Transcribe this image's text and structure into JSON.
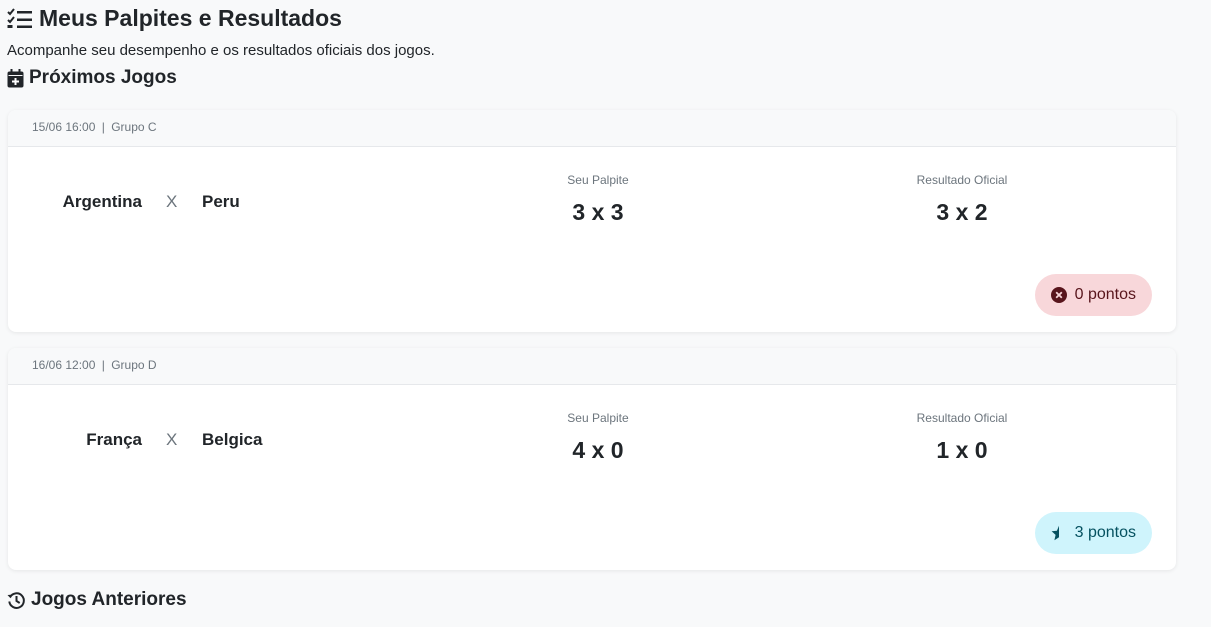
{
  "header": {
    "title": "Meus Palpites e Resultados",
    "subtitle": "Acompanhe seu desempenho e os resultados oficiais dos jogos.",
    "title_icon": "list-check-icon"
  },
  "sections": {
    "upcoming": {
      "title": "Próximos Jogos",
      "icon": "calendar-plus-icon"
    },
    "previous": {
      "title": "Jogos Anteriores",
      "icon": "clock-history-icon"
    }
  },
  "matches": [
    {
      "datetime": "15/06 16:00",
      "separator": "|",
      "group": "Grupo C",
      "home": "Argentina",
      "vs": "X",
      "away": "Peru",
      "guess_label": "Seu Palpite",
      "guess": "3 x 3",
      "result_label": "Resultado Oficial",
      "result": "3 x 2",
      "points": "0 pontos",
      "points_icon": "x-circle-icon"
    },
    {
      "datetime": "16/06 12:00",
      "separator": "|",
      "group": "Grupo D",
      "home": "França",
      "vs": "X",
      "away": "Belgica",
      "guess_label": "Seu Palpite",
      "guess": "4 x 0",
      "result_label": "Resultado Oficial",
      "result": "1 x 0",
      "points": "3 pontos",
      "points_icon": "star-half-icon"
    }
  ],
  "colors": {
    "zero_badge_bg": "#f8d7da",
    "zero_badge_text": "#58151c",
    "three_badge_bg": "#cff4fc",
    "three_badge_text": "#055160"
  }
}
